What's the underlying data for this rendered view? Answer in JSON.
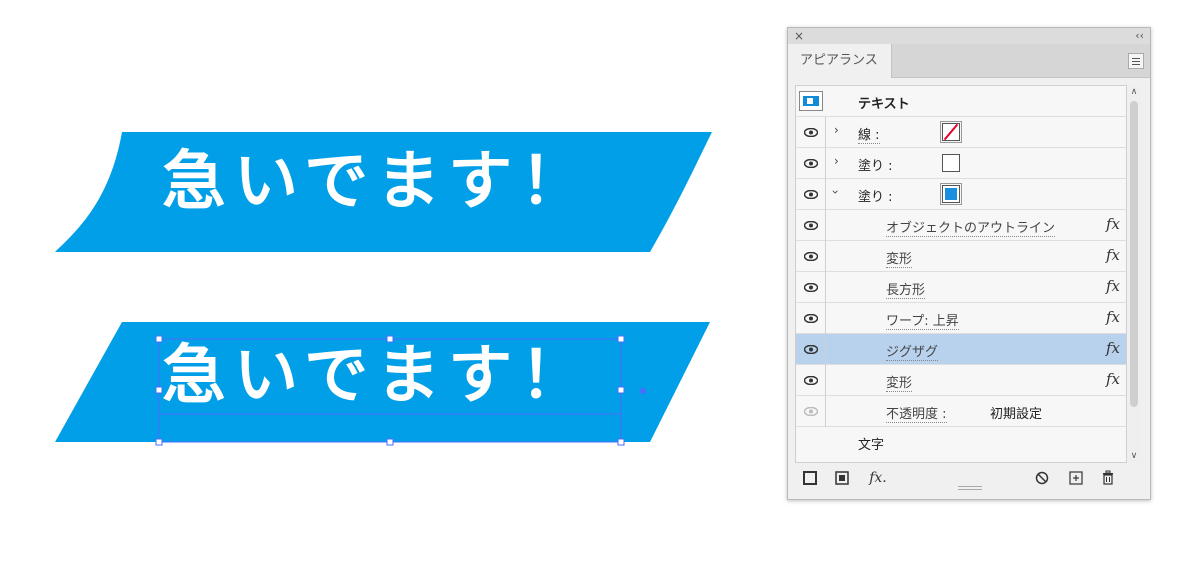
{
  "artwork": {
    "banner_top_text": "急いでます！",
    "banner_bottom_text": "急いでます！",
    "banner_color": "#009fe8",
    "selection_color": "#4a6cff"
  },
  "panel": {
    "close_icon": "×",
    "collapse_icon": "‹‹",
    "tab_label": "アピアランス",
    "rows": {
      "header": "テキスト",
      "stroke_label": "線 :",
      "fill1_label": "塗り :",
      "fill2_label": "塗り :",
      "effect1": "オブジェクトのアウトライン",
      "effect2": "変形",
      "effect3": "長方形",
      "effect4": "ワープ: 上昇",
      "effect5": "ジグザグ",
      "effect6": "変形",
      "opacity_label": "不透明度 :",
      "opacity_value": "初期設定",
      "characters": "文字"
    },
    "fx_label": "fx",
    "toolbar": {
      "add_stroke_icon": "square-outline-icon",
      "add_fill_icon": "square-filled-icon",
      "fx_button": "fx.",
      "clear_icon": "no-icon",
      "duplicate_icon": "plus-square-icon",
      "delete_icon": "trash-icon"
    }
  }
}
